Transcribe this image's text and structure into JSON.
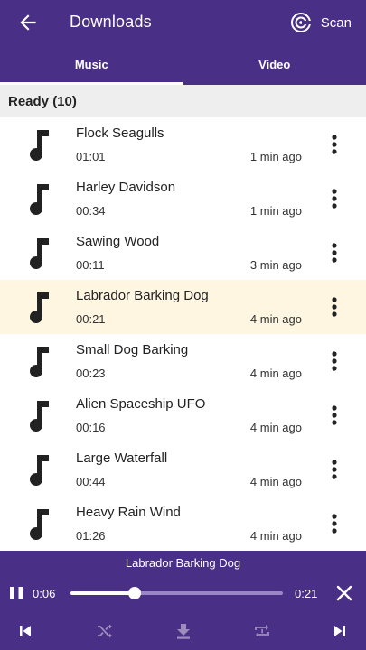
{
  "app_bar": {
    "title": "Downloads",
    "back_icon": "arrow-left-icon",
    "scan_icon": "scan-target-icon",
    "scan_label": "Scan",
    "background": "#4a2f86"
  },
  "tabs": [
    {
      "label": "Music",
      "active": true
    },
    {
      "label": "Video",
      "active": false
    }
  ],
  "section": {
    "label": "Ready (10)"
  },
  "items": [
    {
      "title": "Flock Seagulls",
      "duration": "01:01",
      "ago": "1 min ago",
      "selected": false
    },
    {
      "title": "Harley Davidson",
      "duration": "00:34",
      "ago": "1 min ago",
      "selected": false
    },
    {
      "title": "Sawing Wood",
      "duration": "00:11",
      "ago": "3 min ago",
      "selected": false
    },
    {
      "title": "Labrador Barking Dog",
      "duration": "00:21",
      "ago": "4 min ago",
      "selected": true
    },
    {
      "title": "Small Dog Barking",
      "duration": "00:23",
      "ago": "4 min ago",
      "selected": false
    },
    {
      "title": "Alien Spaceship UFO",
      "duration": "00:16",
      "ago": "4 min ago",
      "selected": false
    },
    {
      "title": "Large Waterfall",
      "duration": "00:44",
      "ago": "4 min ago",
      "selected": false
    },
    {
      "title": "Heavy Rain Wind",
      "duration": "01:26",
      "ago": "4 min ago",
      "selected": false
    }
  ],
  "player": {
    "now_playing": "Labrador Barking Dog",
    "current_time": "0:06",
    "total_time": "0:21",
    "progress": 0.3,
    "controls": [
      "skip-previous-icon",
      "shuffle-icon",
      "download-icon",
      "repeat-one-icon",
      "skip-next-icon"
    ],
    "selected_row_color": "#fff6e2"
  }
}
